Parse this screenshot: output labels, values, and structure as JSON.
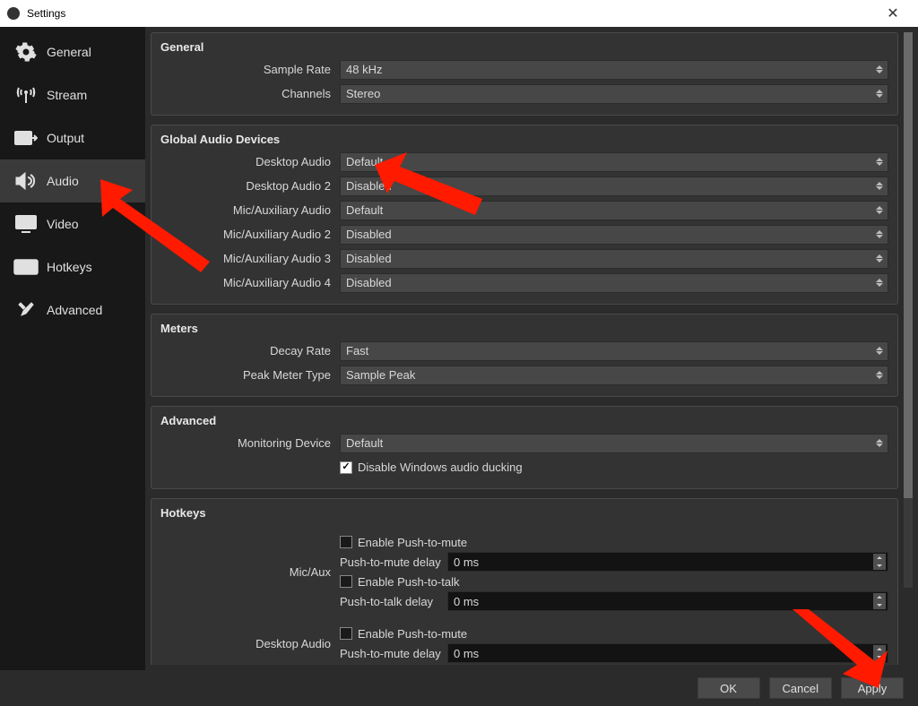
{
  "window": {
    "title": "Settings"
  },
  "sidebar": {
    "items": [
      {
        "id": "general",
        "label": "General"
      },
      {
        "id": "stream",
        "label": "Stream"
      },
      {
        "id": "output",
        "label": "Output"
      },
      {
        "id": "audio",
        "label": "Audio"
      },
      {
        "id": "video",
        "label": "Video"
      },
      {
        "id": "hotkeys",
        "label": "Hotkeys"
      },
      {
        "id": "advanced",
        "label": "Advanced"
      }
    ],
    "selected": "audio"
  },
  "groups": {
    "general": {
      "title": "General",
      "sample_rate_label": "Sample Rate",
      "sample_rate_value": "48 kHz",
      "channels_label": "Channels",
      "channels_value": "Stereo"
    },
    "devices": {
      "title": "Global Audio Devices",
      "desktop_audio_label": "Desktop Audio",
      "desktop_audio_value": "Default",
      "desktop_audio2_label": "Desktop Audio 2",
      "desktop_audio2_value": "Disabled",
      "mic_aux_label": "Mic/Auxiliary Audio",
      "mic_aux_value": "Default",
      "mic_aux2_label": "Mic/Auxiliary Audio 2",
      "mic_aux2_value": "Disabled",
      "mic_aux3_label": "Mic/Auxiliary Audio 3",
      "mic_aux3_value": "Disabled",
      "mic_aux4_label": "Mic/Auxiliary Audio 4",
      "mic_aux4_value": "Disabled"
    },
    "meters": {
      "title": "Meters",
      "decay_label": "Decay Rate",
      "decay_value": "Fast",
      "peak_label": "Peak Meter Type",
      "peak_value": "Sample Peak"
    },
    "advanced": {
      "title": "Advanced",
      "monitoring_label": "Monitoring Device",
      "monitoring_value": "Default",
      "ducking_label": "Disable Windows audio ducking",
      "ducking_checked": true
    },
    "hotkeys": {
      "title": "Hotkeys",
      "micaux_label": "Mic/Aux",
      "desktop_label": "Desktop Audio",
      "ptm_label": "Enable Push-to-mute",
      "ptm_delay_label": "Push-to-mute delay",
      "ptm_delay_value": "0 ms",
      "ptt_label": "Enable Push-to-talk",
      "ptt_delay_label": "Push-to-talk delay",
      "ptt_delay_value": "0 ms"
    }
  },
  "footer": {
    "ok": "OK",
    "cancel": "Cancel",
    "apply": "Apply"
  }
}
